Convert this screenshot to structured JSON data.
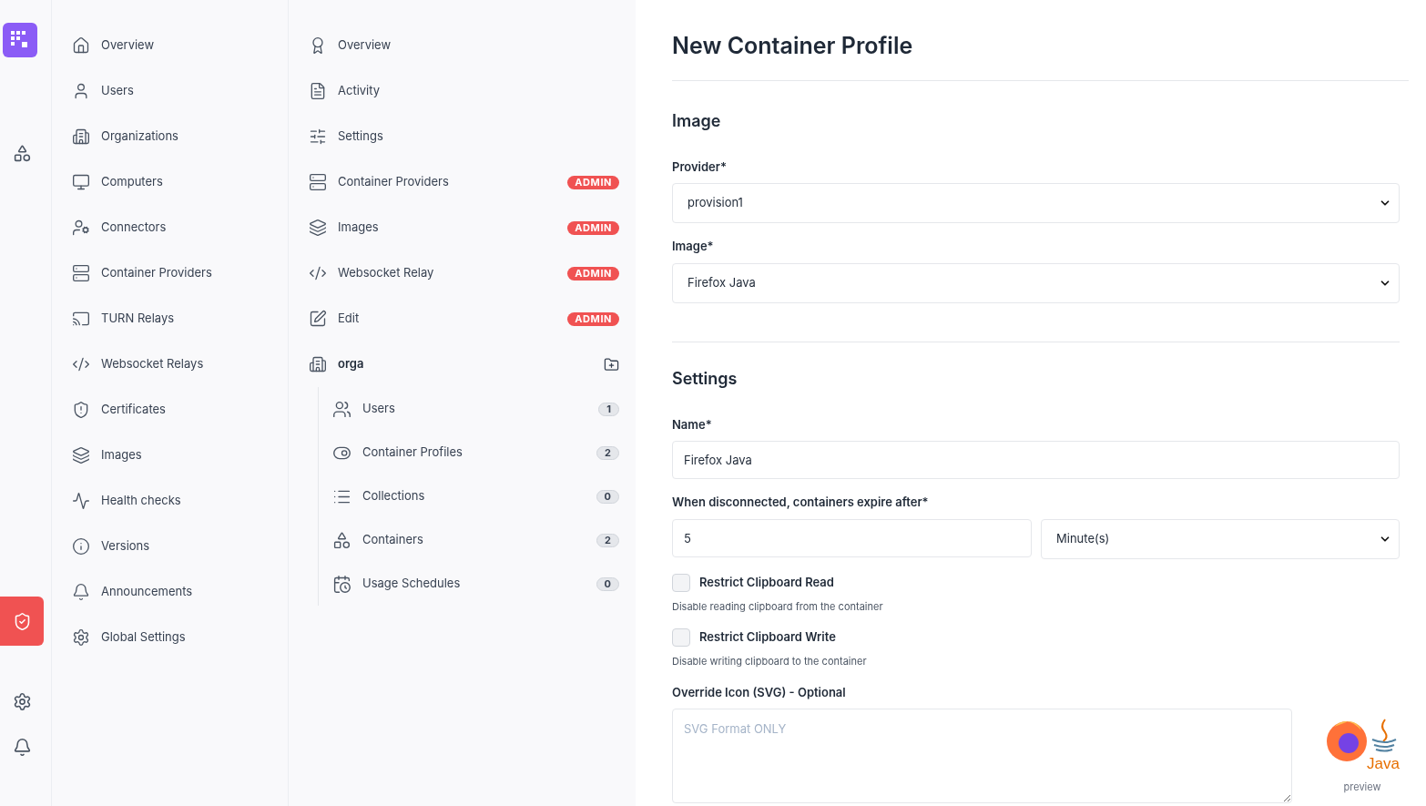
{
  "rail": {
    "items": [
      {
        "kind": "apps",
        "selected": false
      },
      {
        "kind": "admin",
        "selected": true
      },
      {
        "kind": "settings",
        "selected": false
      },
      {
        "kind": "notifications",
        "selected": false
      }
    ]
  },
  "main_nav": {
    "items": [
      {
        "label": "Overview"
      },
      {
        "label": "Users"
      },
      {
        "label": "Organizations"
      },
      {
        "label": "Computers"
      },
      {
        "label": "Connectors"
      },
      {
        "label": "Container Providers"
      },
      {
        "label": "TURN Relays"
      },
      {
        "label": "Websocket Relays"
      },
      {
        "label": "Certificates"
      },
      {
        "label": "Images"
      },
      {
        "label": "Health checks"
      },
      {
        "label": "Versions"
      },
      {
        "label": "Announcements"
      },
      {
        "label": "Global Settings"
      }
    ]
  },
  "sub_nav": {
    "items": [
      {
        "label": "Overview"
      },
      {
        "label": "Activity"
      },
      {
        "label": "Settings"
      },
      {
        "label": "Container Providers",
        "badge": "ADMIN"
      },
      {
        "label": "Images",
        "badge": "ADMIN"
      },
      {
        "label": "Websocket Relay",
        "badge": "ADMIN"
      },
      {
        "label": "Edit",
        "badge": "ADMIN"
      }
    ],
    "group": {
      "label": "orga",
      "children": [
        {
          "label": "Users",
          "count": "1"
        },
        {
          "label": "Container Profiles",
          "count": "2"
        },
        {
          "label": "Collections",
          "count": "0"
        },
        {
          "label": "Containers",
          "count": "2"
        },
        {
          "label": "Usage Schedules",
          "count": "0"
        }
      ]
    }
  },
  "page": {
    "title": "New Container Profile",
    "image_section": {
      "heading": "Image",
      "provider": {
        "label": "Provider*",
        "value": "provision1"
      },
      "image": {
        "label": "Image*",
        "value": "Firefox Java"
      }
    },
    "settings_section": {
      "heading": "Settings",
      "name": {
        "label": "Name*",
        "value": "Firefox Java"
      },
      "expire": {
        "label": "When disconnected, containers expire after*",
        "value": "5",
        "unit": "Minute(s)"
      },
      "checkboxes": [
        {
          "label": "Restrict Clipboard Read",
          "help": "Disable reading clipboard from the container",
          "checked": false
        },
        {
          "label": "Restrict Clipboard Write",
          "help": "Disable writing clipboard to the container",
          "checked": false
        }
      ],
      "icon_field": {
        "label": "Override Icon (SVG) - Optional",
        "placeholder": "SVG Format ONLY"
      },
      "preview": {
        "logo_text": "Java",
        "caption": "preview"
      }
    }
  }
}
